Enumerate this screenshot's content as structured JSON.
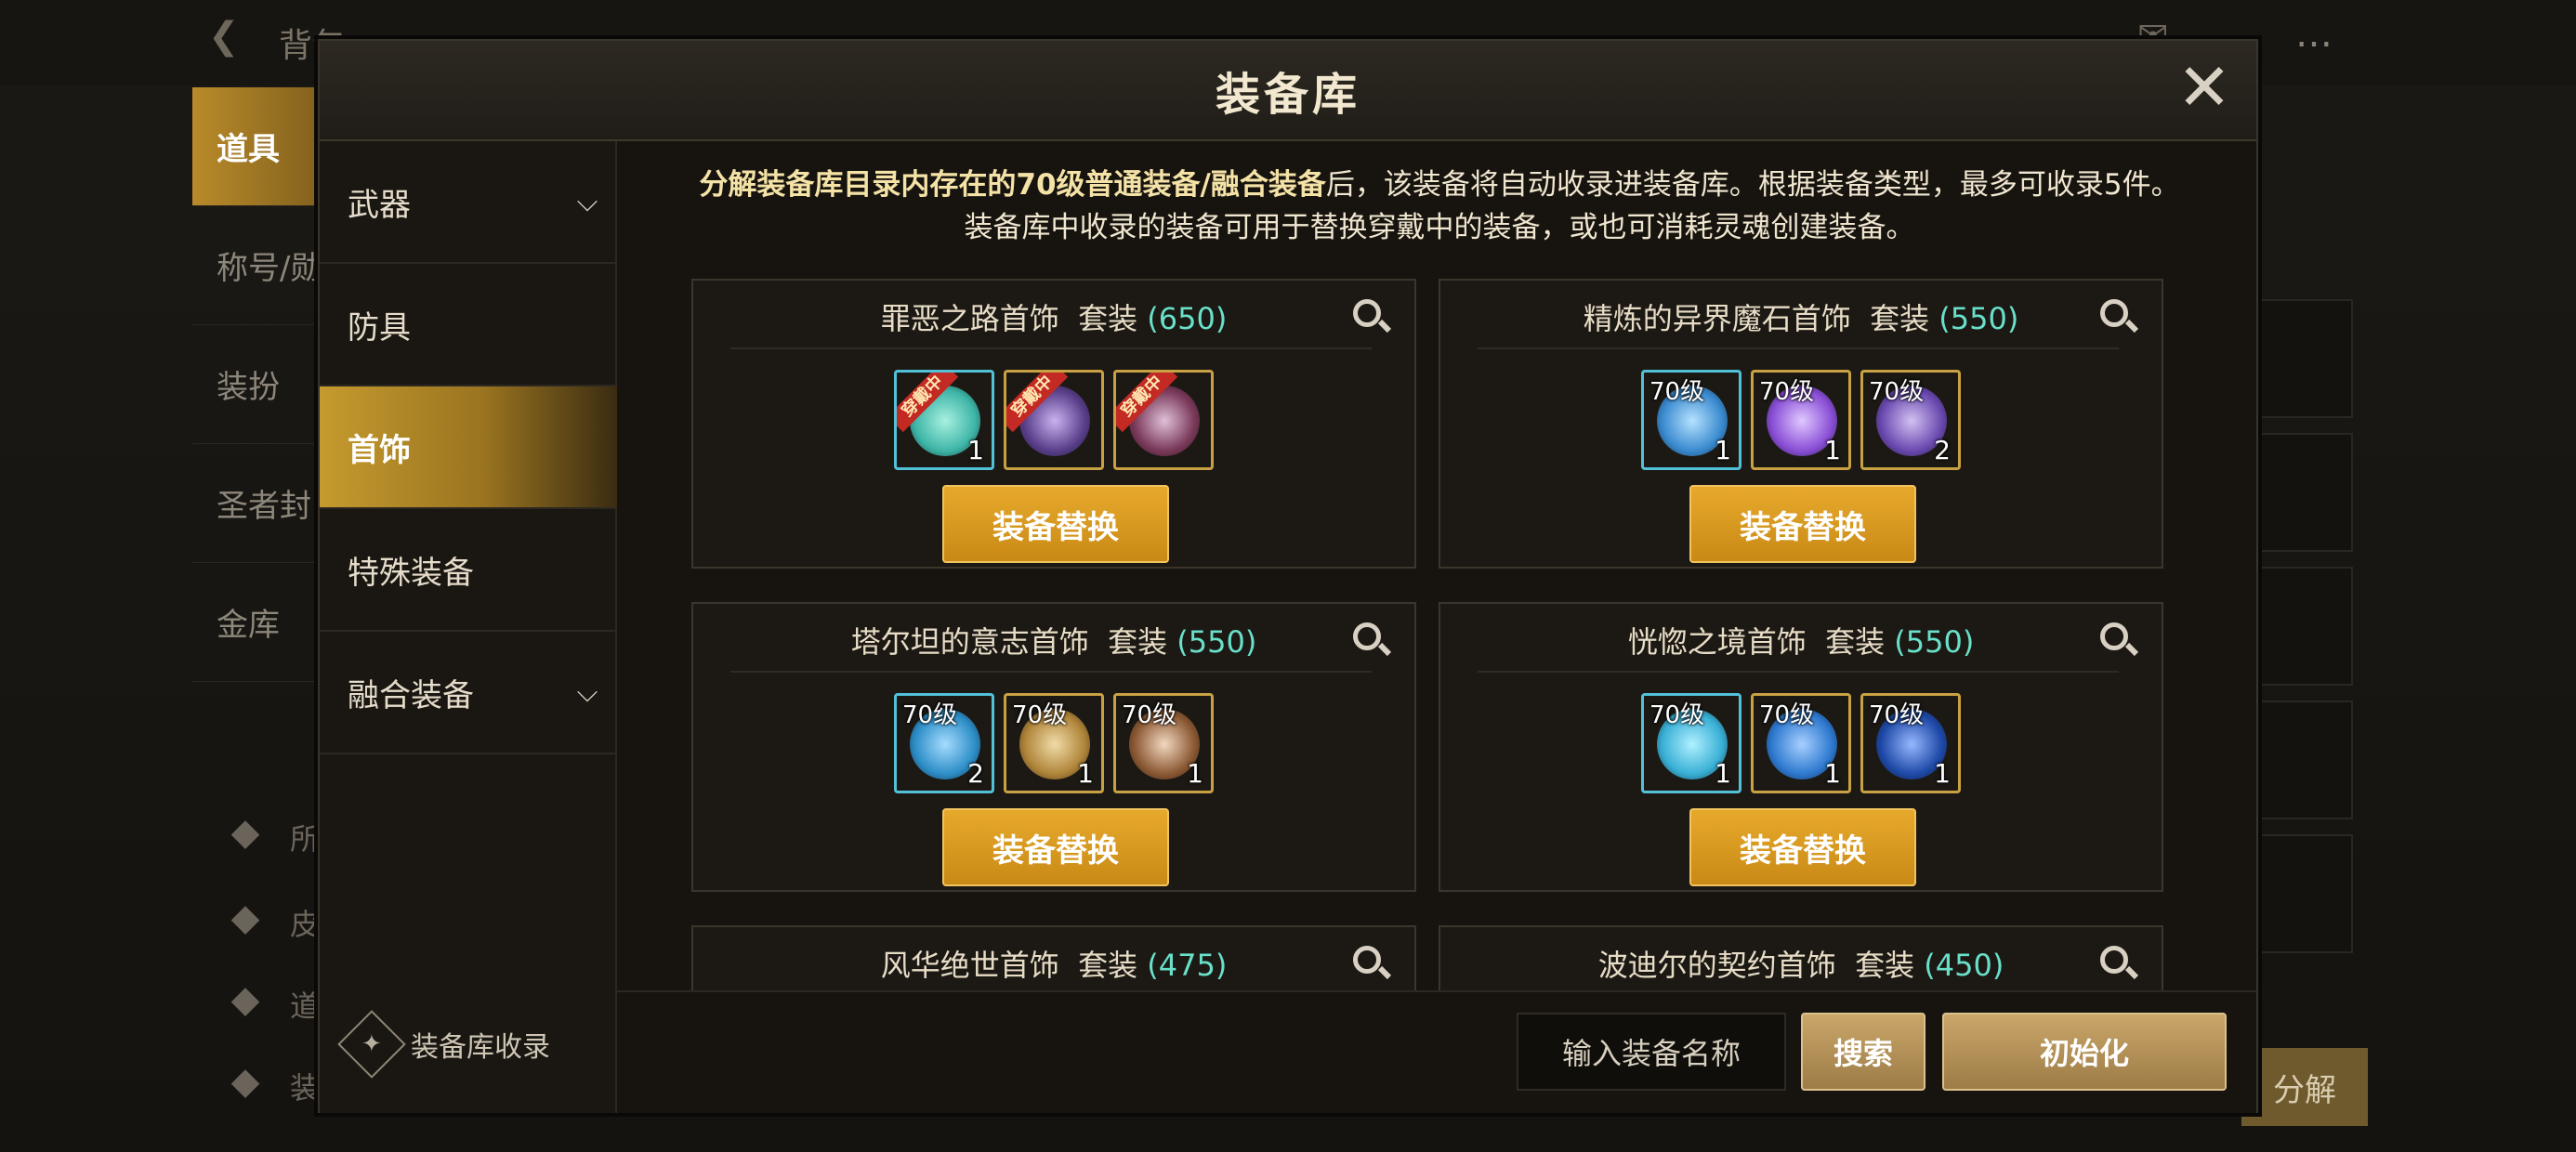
{
  "background": {
    "back_label": "背包",
    "tabs": [
      "道具",
      "称号/勋",
      "装扮",
      "圣者封",
      "金库"
    ],
    "side_items": [
      "所",
      "皮",
      "道",
      "装"
    ],
    "decompose_label": "分解"
  },
  "modal": {
    "title": "装备库",
    "close_icon": "close-icon",
    "description_part1": "分解装备库目录内存在的70级普通装备/融合装备",
    "description_part2": "后，该装备将自动收录进装备库。根据装备类型，最多可收录5件。",
    "description_line2": "装备库中收录的装备可用于替换穿戴中的装备，或也可消耗灵魂创建装备。",
    "categories": [
      {
        "label": "武器",
        "expandable": true
      },
      {
        "label": "防具",
        "expandable": false
      },
      {
        "label": "首饰",
        "expandable": false,
        "active": true
      },
      {
        "label": "特殊装备",
        "expandable": false
      },
      {
        "label": "融合装备",
        "expandable": true
      }
    ],
    "collect_label": "装备库收录",
    "sets": [
      {
        "name": "罪恶之路首饰",
        "type": "套装",
        "count": "(650)",
        "replace_label": "装备替换",
        "items": [
          {
            "level": "",
            "count": "1",
            "wearing": "穿戴中",
            "frame": "blue",
            "color": "#3fb6a8"
          },
          {
            "level": "",
            "count": "",
            "wearing": "穿戴中",
            "frame": "gold",
            "color": "#5a3f8a"
          },
          {
            "level": "",
            "count": "",
            "wearing": "穿戴中",
            "frame": "gold",
            "color": "#7a3a5a"
          }
        ]
      },
      {
        "name": "精炼的异界魔石首饰",
        "type": "套装",
        "count": "(550)",
        "replace_label": "装备替换",
        "items": [
          {
            "level": "70级",
            "count": "1",
            "wearing": "",
            "frame": "blue",
            "color": "#3b8bd0"
          },
          {
            "level": "70级",
            "count": "1",
            "wearing": "",
            "frame": "gold",
            "color": "#8a4fd6"
          },
          {
            "level": "70级",
            "count": "2",
            "wearing": "",
            "frame": "gold",
            "color": "#6b4ab0"
          }
        ]
      },
      {
        "name": "塔尔坦的意志首饰",
        "type": "套装",
        "count": "(550)",
        "replace_label": "装备替换",
        "items": [
          {
            "level": "70级",
            "count": "2",
            "wearing": "",
            "frame": "blue",
            "color": "#2e8fc8"
          },
          {
            "level": "70级",
            "count": "1",
            "wearing": "",
            "frame": "gold",
            "color": "#b0853a"
          },
          {
            "level": "70级",
            "count": "1",
            "wearing": "",
            "frame": "gold",
            "color": "#8c5a35"
          }
        ]
      },
      {
        "name": "恍惚之境首饰",
        "type": "套装",
        "count": "(550)",
        "replace_label": "装备替换",
        "items": [
          {
            "level": "70级",
            "count": "1",
            "wearing": "",
            "frame": "blue",
            "color": "#3ab0d6"
          },
          {
            "level": "70级",
            "count": "1",
            "wearing": "",
            "frame": "gold",
            "color": "#2f7ad0"
          },
          {
            "level": "70级",
            "count": "1",
            "wearing": "",
            "frame": "gold",
            "color": "#1f4aa8"
          }
        ]
      },
      {
        "name": "风华绝世首饰",
        "type": "套装",
        "count": "(475)"
      },
      {
        "name": "波迪尔的契约首饰",
        "type": "套装",
        "count": "(450)"
      }
    ],
    "search_placeholder": "输入装备名称",
    "search_label": "搜索",
    "reset_label": "初始化"
  },
  "colors": {
    "count_color": "#69e0c9",
    "button_gold": "#e7a92c",
    "active_category": "#c59a2e"
  }
}
